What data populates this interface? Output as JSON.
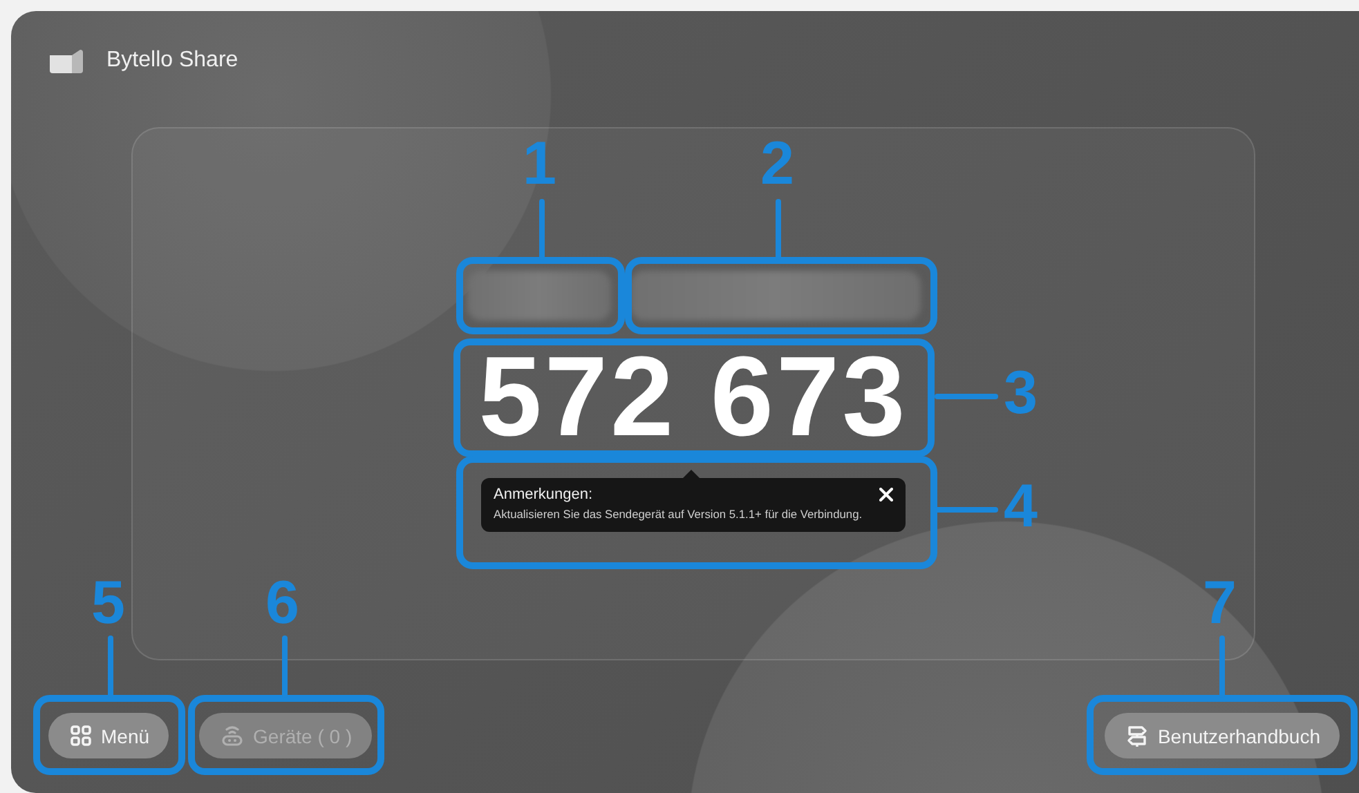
{
  "app": {
    "title": "Bytello Share"
  },
  "pairing_code": "572 673",
  "note": {
    "title": "Anmerkungen:",
    "text": "Aktualisieren Sie das Sendegerät auf Version 5.1.1+ für die Verbindung."
  },
  "buttons": [
    {
      "kind": "menu",
      "label": "Menü",
      "disabled": false
    },
    {
      "kind": "devices",
      "label": "Geräte ( 0 )",
      "disabled": true
    },
    {
      "kind": "manual",
      "label": "Benutzerhandbuch",
      "disabled": false
    }
  ],
  "callouts": [
    {
      "label": "1"
    },
    {
      "label": "2"
    },
    {
      "label": "3"
    },
    {
      "label": "4"
    },
    {
      "label": "5"
    },
    {
      "label": "6"
    },
    {
      "label": "7"
    }
  ]
}
